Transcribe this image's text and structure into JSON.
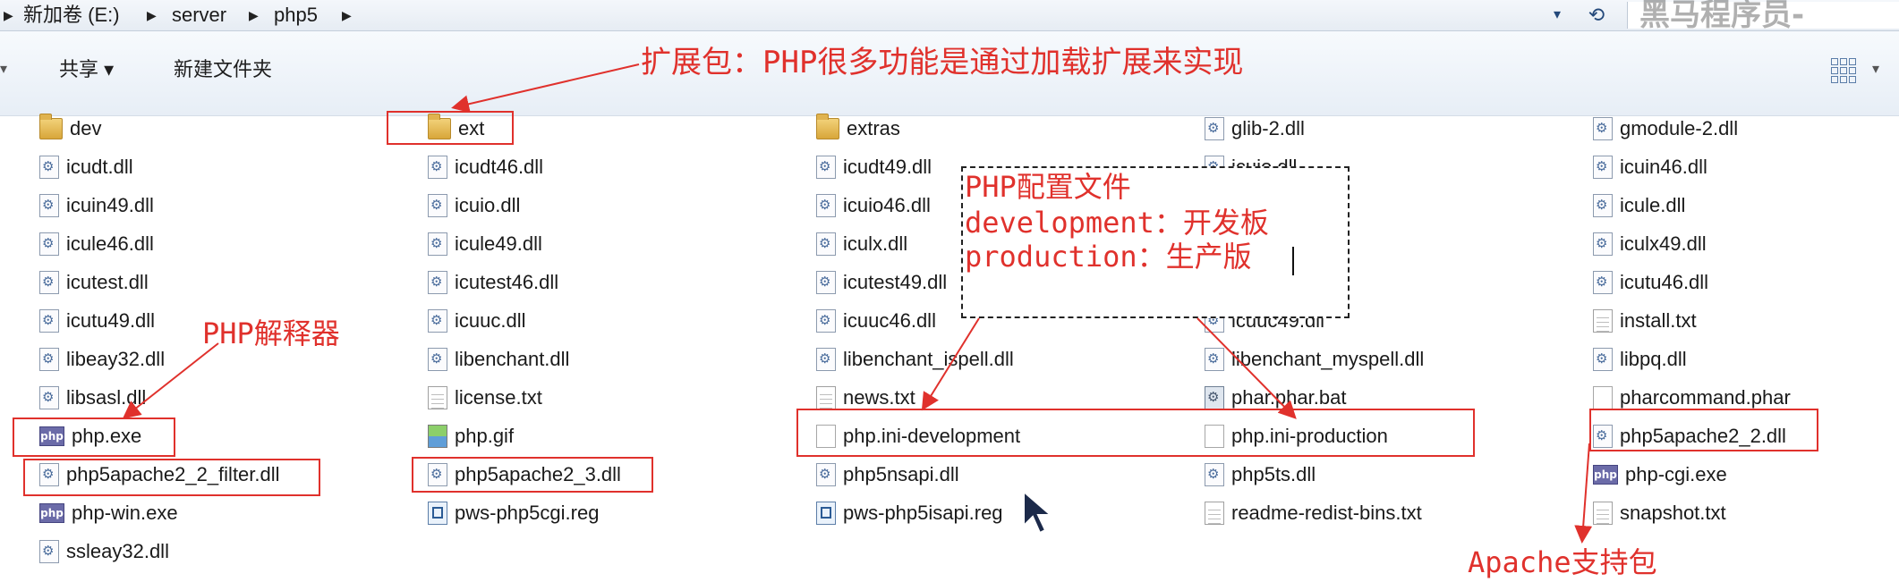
{
  "address_bar": {
    "crumbs": [
      "新加卷 (E:)",
      "server",
      "php5"
    ],
    "separator": "▶",
    "dropdown_glyph": "▾",
    "refresh_glyph": "⟲",
    "watermark": "黑马程序员-"
  },
  "toolbar": {
    "share_label": "共享 ▾",
    "new_folder_label": "新建文件夹"
  },
  "files": [
    {
      "name": "dev",
      "icon": "folder"
    },
    {
      "name": "icudt.dll",
      "icon": "dll"
    },
    {
      "name": "icuin49.dll",
      "icon": "dll"
    },
    {
      "name": "icule46.dll",
      "icon": "dll"
    },
    {
      "name": "icutest.dll",
      "icon": "dll"
    },
    {
      "name": "icutu49.dll",
      "icon": "dll"
    },
    {
      "name": "libeay32.dll",
      "icon": "dll"
    },
    {
      "name": "libsasl.dll",
      "icon": "dll"
    },
    {
      "name": "php.exe",
      "icon": "php"
    },
    {
      "name": "php5apache2_2_filter.dll",
      "icon": "dll"
    },
    {
      "name": "php-win.exe",
      "icon": "php"
    },
    {
      "name": "ssleay32.dll",
      "icon": "dll"
    },
    {
      "name": "ext",
      "icon": "folder"
    },
    {
      "name": "icudt46.dll",
      "icon": "dll"
    },
    {
      "name": "icuio.dll",
      "icon": "dll"
    },
    {
      "name": "icule49.dll",
      "icon": "dll"
    },
    {
      "name": "icutest46.dll",
      "icon": "dll"
    },
    {
      "name": "icuuc.dll",
      "icon": "dll"
    },
    {
      "name": "libenchant.dll",
      "icon": "dll"
    },
    {
      "name": "license.txt",
      "icon": "txt"
    },
    {
      "name": "php.gif",
      "icon": "gif"
    },
    {
      "name": "php5apache2_3.dll",
      "icon": "dll"
    },
    {
      "name": "pws-php5cgi.reg",
      "icon": "reg"
    },
    {
      "name": "extras",
      "icon": "folder"
    },
    {
      "name": "icudt49.dll",
      "icon": "dll"
    },
    {
      "name": "icuio46.dll",
      "icon": "dll"
    },
    {
      "name": "iculx.dll",
      "icon": "dll"
    },
    {
      "name": "icutest49.dll",
      "icon": "dll"
    },
    {
      "name": "icuuc46.dll",
      "icon": "dll"
    },
    {
      "name": "libenchant_ispell.dll",
      "icon": "dll"
    },
    {
      "name": "news.txt",
      "icon": "txt"
    },
    {
      "name": "php.ini-development",
      "icon": "blank"
    },
    {
      "name": "php5nsapi.dll",
      "icon": "dll"
    },
    {
      "name": "pws-php5isapi.reg",
      "icon": "reg"
    },
    {
      "name": "glib-2.dll",
      "icon": "dll"
    },
    {
      "name": "icuio.dll",
      "icon": "dll"
    },
    {
      "name": "icuuc49.dll",
      "icon": "dll"
    },
    {
      "name": "libenchant_myspell.dll",
      "icon": "dll"
    },
    {
      "name": "phar.phar.bat",
      "icon": "bat"
    },
    {
      "name": "php.ini-production",
      "icon": "blank"
    },
    {
      "name": "php5ts.dll",
      "icon": "dll"
    },
    {
      "name": "readme-redist-bins.txt",
      "icon": "txt"
    },
    {
      "name": "gmodule-2.dll",
      "icon": "dll"
    },
    {
      "name": "icuin46.dll",
      "icon": "dll"
    },
    {
      "name": "icule.dll",
      "icon": "dll"
    },
    {
      "name": "iculx49.dll",
      "icon": "dll"
    },
    {
      "name": "icutu46.dll",
      "icon": "dll"
    },
    {
      "name": "install.txt",
      "icon": "txt"
    },
    {
      "name": "libpq.dll",
      "icon": "dll"
    },
    {
      "name": "pharcommand.phar",
      "icon": "blank"
    },
    {
      "name": "php5apache2_2.dll",
      "icon": "dll"
    },
    {
      "name": "php-cgi.exe",
      "icon": "php"
    },
    {
      "name": "snapshot.txt",
      "icon": "txt"
    }
  ],
  "annotations": {
    "ext_note": "扩展包：PHP很多功能是通过加载扩展来实现",
    "exe_note": "PHP解释器",
    "config_line1": "PHP配置文件",
    "config_line2": "development：开发板",
    "config_line3": "production：生产版",
    "apache_note": "Apache支持包",
    "color": "#e0312c"
  }
}
